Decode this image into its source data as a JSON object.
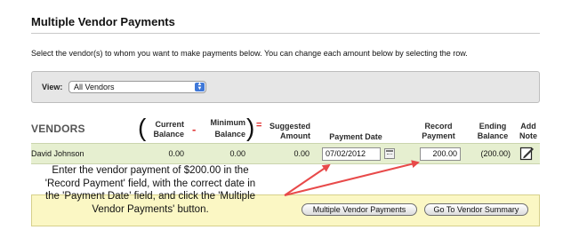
{
  "page": {
    "title": "Multiple Vendor Payments",
    "instructions": "Select the vendor(s) to whom you want to make payments below. You can change each amount below by selecting the row."
  },
  "filter": {
    "label": "View:",
    "selected": "All Vendors"
  },
  "table": {
    "vendors_header": "VENDORS",
    "headers": {
      "current_balance_line1": "Current",
      "current_balance_line2": "Balance",
      "minimum_balance_line1": "Minimum",
      "minimum_balance_line2": "Balance",
      "suggested_amount_line1": "Suggested",
      "suggested_amount_line2": "Amount",
      "payment_date": "Payment Date",
      "record_payment_line1": "Record",
      "record_payment_line2": "Payment",
      "ending_balance_line1": "Ending",
      "ending_balance_line2": "Balance",
      "add_note_line1": "Add",
      "add_note_line2": "Note"
    },
    "operators": {
      "open_paren": "(",
      "minus": "-",
      "close_paren": ")",
      "equals": "="
    },
    "rows": [
      {
        "vendor": "David Johnson",
        "current_balance": "0.00",
        "minimum_balance": "0.00",
        "suggested_amount": "0.00",
        "payment_date": "07/02/2012",
        "record_payment": "200.00",
        "ending_balance": "(200.00)"
      }
    ]
  },
  "buttons": {
    "multiple_vendor_payments": "Multiple Vendor Payments",
    "go_to_vendor_summary": "Go To Vendor Summary"
  },
  "callout": {
    "line1": "Enter the vendor payment of $200.00 in the",
    "line2": "'Record Payment' field, with the correct date in",
    "line3": "the 'Payment Date' field, and click the 'Multiple",
    "line4": "Vendor Payments' button."
  },
  "colors": {
    "row_highlight": "#e6efd0",
    "footer_bar": "#fbf7c4",
    "annotation_arrow": "#e84a4a",
    "operator_red": "#e03030",
    "select_accent": "#3f78d8"
  }
}
